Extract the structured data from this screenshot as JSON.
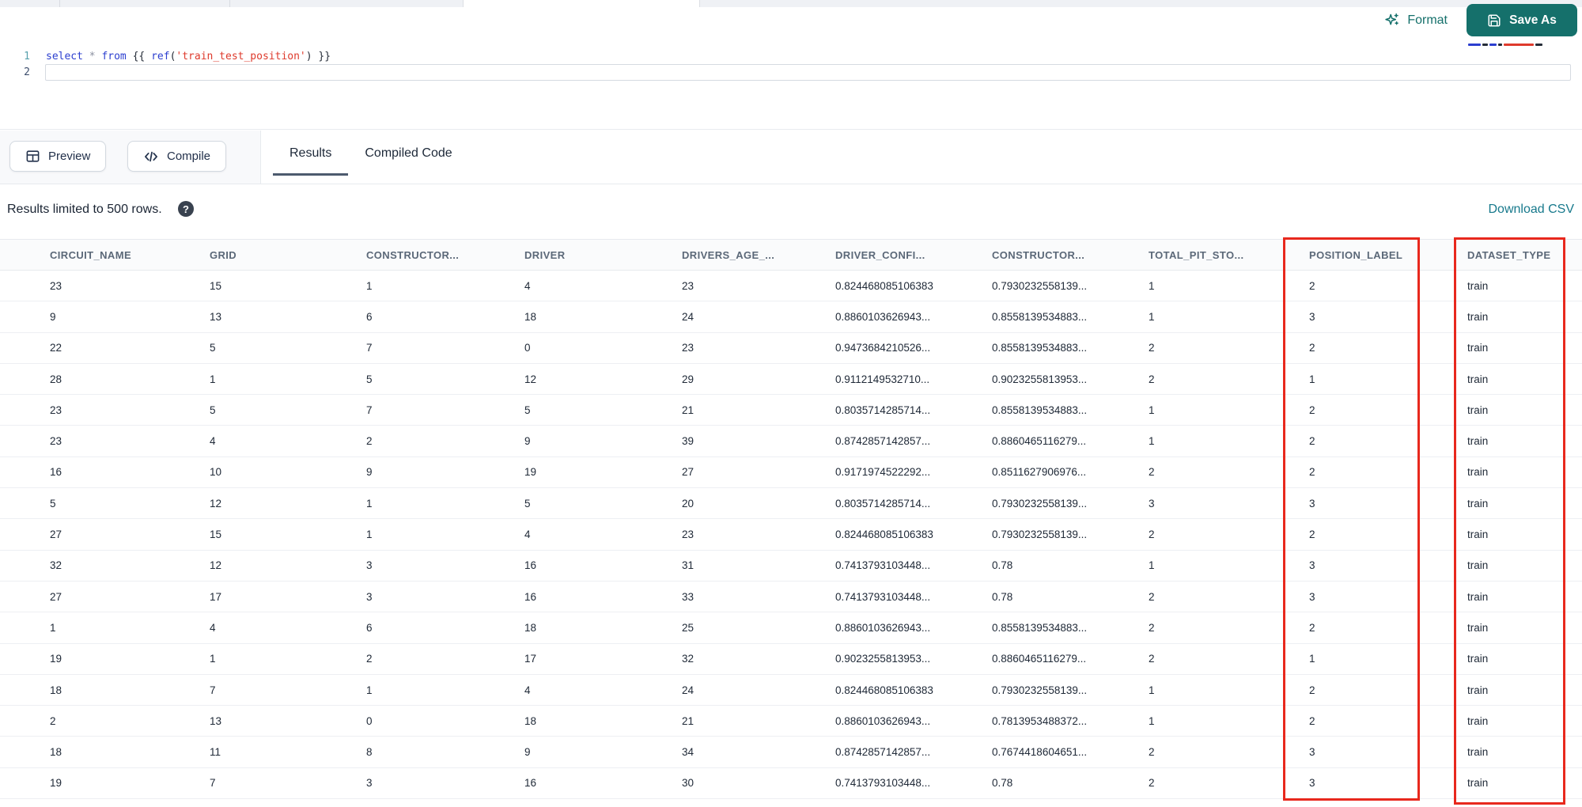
{
  "toolbar": {
    "format_label": "Format",
    "save_as_label": "Save As"
  },
  "editor": {
    "lines": [
      {
        "number": "1",
        "tokens": [
          {
            "text": "select",
            "color": "#2b3ecf"
          },
          {
            "text": " ",
            "color": "#252c38"
          },
          {
            "text": "*",
            "color": "#8b90a0"
          },
          {
            "text": " ",
            "color": "#252c38"
          },
          {
            "text": "from",
            "color": "#2b3ecf"
          },
          {
            "text": " {{ ",
            "color": "#252c38"
          },
          {
            "text": "ref",
            "color": "#2b3ecf"
          },
          {
            "text": "(",
            "color": "#252c38"
          },
          {
            "text": "'train_test_position'",
            "color": "#de3a2c"
          },
          {
            "text": ")",
            "color": "#252c38"
          },
          {
            "text": " }}",
            "color": "#252c38"
          }
        ]
      },
      {
        "number": "2",
        "tokens": []
      }
    ]
  },
  "actions": {
    "preview_label": "Preview",
    "compile_label": "Compile"
  },
  "tabs": [
    {
      "label": "Results",
      "active": true
    },
    {
      "label": "Compiled Code",
      "active": false
    }
  ],
  "results_bar": {
    "info": "Results limited to 500 rows.",
    "help_glyph": "?",
    "download_label": "Download CSV"
  },
  "table": {
    "columns": [
      "CIRCUIT_NAME",
      "GRID",
      "CONSTRUCTOR...",
      "DRIVER",
      "DRIVERS_AGE_...",
      "DRIVER_CONFI...",
      "CONSTRUCTOR...",
      "TOTAL_PIT_STO...",
      "POSITION_LABEL",
      "DATASET_TYPE"
    ],
    "rows": [
      [
        "23",
        "15",
        "1",
        "4",
        "23",
        "0.824468085106383",
        "0.7930232558139...",
        "1",
        "2",
        "train"
      ],
      [
        "9",
        "13",
        "6",
        "18",
        "24",
        "0.8860103626943...",
        "0.8558139534883...",
        "1",
        "3",
        "train"
      ],
      [
        "22",
        "5",
        "7",
        "0",
        "23",
        "0.9473684210526...",
        "0.8558139534883...",
        "2",
        "2",
        "train"
      ],
      [
        "28",
        "1",
        "5",
        "12",
        "29",
        "0.9112149532710...",
        "0.9023255813953...",
        "2",
        "1",
        "train"
      ],
      [
        "23",
        "5",
        "7",
        "5",
        "21",
        "0.8035714285714...",
        "0.8558139534883...",
        "1",
        "2",
        "train"
      ],
      [
        "23",
        "4",
        "2",
        "9",
        "39",
        "0.8742857142857...",
        "0.8860465116279...",
        "1",
        "2",
        "train"
      ],
      [
        "16",
        "10",
        "9",
        "19",
        "27",
        "0.9171974522292...",
        "0.8511627906976...",
        "2",
        "2",
        "train"
      ],
      [
        "5",
        "12",
        "1",
        "5",
        "20",
        "0.8035714285714...",
        "0.7930232558139...",
        "3",
        "3",
        "train"
      ],
      [
        "27",
        "15",
        "1",
        "4",
        "23",
        "0.824468085106383",
        "0.7930232558139...",
        "2",
        "2",
        "train"
      ],
      [
        "32",
        "12",
        "3",
        "16",
        "31",
        "0.7413793103448...",
        "0.78",
        "1",
        "3",
        "train"
      ],
      [
        "27",
        "17",
        "3",
        "16",
        "33",
        "0.7413793103448...",
        "0.78",
        "2",
        "3",
        "train"
      ],
      [
        "1",
        "4",
        "6",
        "18",
        "25",
        "0.8860103626943...",
        "0.8558139534883...",
        "2",
        "2",
        "train"
      ],
      [
        "19",
        "1",
        "2",
        "17",
        "32",
        "0.9023255813953...",
        "0.8860465116279...",
        "2",
        "1",
        "train"
      ],
      [
        "18",
        "7",
        "1",
        "4",
        "24",
        "0.824468085106383",
        "0.7930232558139...",
        "1",
        "2",
        "train"
      ],
      [
        "2",
        "13",
        "0",
        "18",
        "21",
        "0.8860103626943...",
        "0.7813953488372...",
        "1",
        "2",
        "train"
      ],
      [
        "18",
        "11",
        "8",
        "9",
        "34",
        "0.8742857142857...",
        "0.7674418604651...",
        "2",
        "3",
        "train"
      ],
      [
        "19",
        "7",
        "3",
        "16",
        "30",
        "0.7413793103448...",
        "0.78",
        "2",
        "3",
        "train"
      ]
    ],
    "highlighted_columns": [
      "POSITION_LABEL",
      "DATASET_TYPE"
    ]
  },
  "icons": [
    "sparkle-icon",
    "floppy-disk-icon",
    "table-grid-icon",
    "code-icon",
    "question-mark-circle-icon"
  ],
  "colors": {
    "accent_teal": "#15706b",
    "link_teal": "#17798c",
    "annotation_red": "#e8281d",
    "keyword_blue": "#2b3ecf",
    "string_red": "#de3a2c"
  }
}
